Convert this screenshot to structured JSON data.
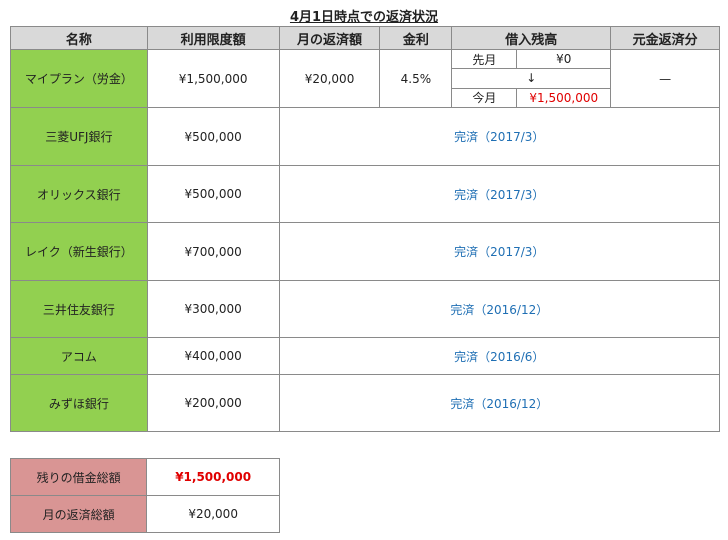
{
  "title": "4月1日時点での返済状況",
  "headers": [
    "名称",
    "利用限度額",
    "月の返済額",
    "金利",
    "借入残高",
    "元金返済分"
  ],
  "first_row": {
    "name": "マイプラン（労金）",
    "limit": "¥1,500,000",
    "monthly": "¥20,000",
    "rate": "4.5%",
    "balance": {
      "prev_label": "先月",
      "prev_value": "¥0",
      "arrow": "↓",
      "curr_label": "今月",
      "curr_value": "¥1,500,000"
    },
    "principal": "—"
  },
  "rows": [
    {
      "name": "三菱UFJ銀行",
      "limit": "¥500,000",
      "status": "完済（2017/3）"
    },
    {
      "name": "オリックス銀行",
      "limit": "¥500,000",
      "status": "完済（2017/3）"
    },
    {
      "name": "レイク（新生銀行）",
      "limit": "¥700,000",
      "status": "完済（2017/3）"
    },
    {
      "name": "三井住友銀行",
      "limit": "¥300,000",
      "status": "完済（2016/12）"
    },
    {
      "name": "アコム",
      "limit": "¥400,000",
      "status": "完済（2016/6）"
    },
    {
      "name": "みずほ銀行",
      "limit": "¥200,000",
      "status": "完済（2016/12）"
    }
  ],
  "summary": {
    "remaining_label": "残りの借金総額",
    "remaining_value": "¥1,500,000",
    "monthly_label": "月の返済総額",
    "monthly_value": "¥20,000"
  }
}
